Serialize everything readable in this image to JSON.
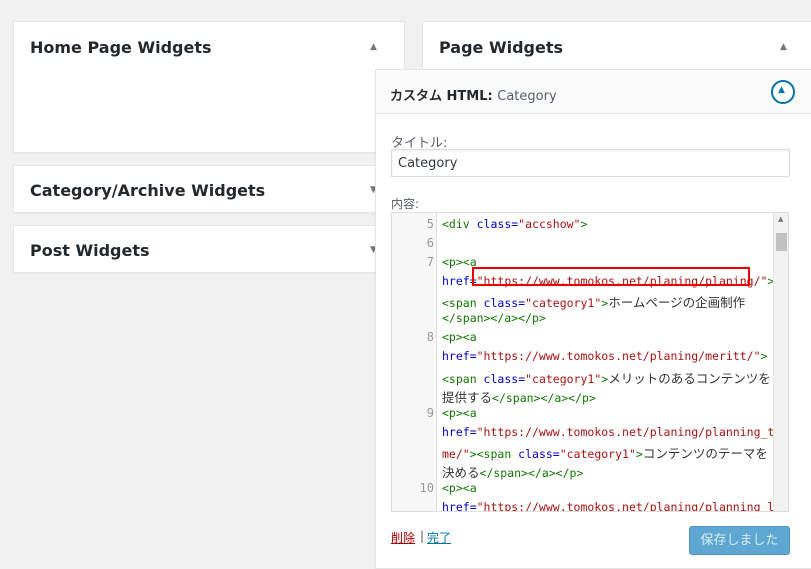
{
  "panels": {
    "home": "Home Page Widgets",
    "category": "Category/Archive Widgets",
    "post": "Post Widgets",
    "page": "Page Widgets"
  },
  "icons": {
    "collapse": "▲",
    "expand": "▼"
  },
  "widget": {
    "title": "カスタム",
    "type": "HTML: ",
    "subtitle": "Category",
    "title_label": "タイトル:",
    "title_value": "Category",
    "content_label": "内容:",
    "delete_label": "削除",
    "separator": "|",
    "done_label": "完了",
    "save_label": "保存しました"
  },
  "editor": {
    "line_numbers": [
      "5",
      "6",
      "7",
      "8",
      "9",
      "10"
    ],
    "lines": {
      "l5_tag": "<div ",
      "l5_attr": "class=",
      "l5_val": "\"accshow\"",
      "l5_end": ">",
      "l7a": "<p><a",
      "l7b_attr": "href=",
      "l7b_val": "\"https://www.tomokos.net/planing/planing/\"",
      "l7b_end": ">",
      "l7c_tag": "<span ",
      "l7c_attr": "class=",
      "l7c_val": "\"category1\"",
      "l7c_end": ">",
      "l7c_text": "ホームページの企画制作",
      "l7d": "</span></a></p>",
      "l8a": "<p><a",
      "l8b_attr": "href=",
      "l8b_val": "\"https://www.tomokos.net/planing/meritt/\"",
      "l8b_end": ">",
      "l8c_tag": "<span ",
      "l8c_attr": "class=",
      "l8c_val": "\"category1\"",
      "l8c_end": ">",
      "l8c_text": "メリットのあるコンテンツを",
      "l8d_text": "提供する",
      "l8d_tag": "</span></a></p>",
      "l9a": "<p><a",
      "l9b_attr": "href=",
      "l9b_val": "\"https://www.tomokos.net/planing/planning_the",
      "l9c_val": "me/\"",
      "l9c_tag1": "><span ",
      "l9c_attr": "class=",
      "l9c_val2": "\"category1\"",
      "l9c_end": ">",
      "l9c_text": "コンテンツのテーマを",
      "l9d_text": "決める",
      "l9d_tag": "</span></a></p>",
      "l10a": "<p><a",
      "l10b_attr": "href=",
      "l10b_val": "\"https://www.tomokos.net/planing/planning_lay"
    }
  }
}
